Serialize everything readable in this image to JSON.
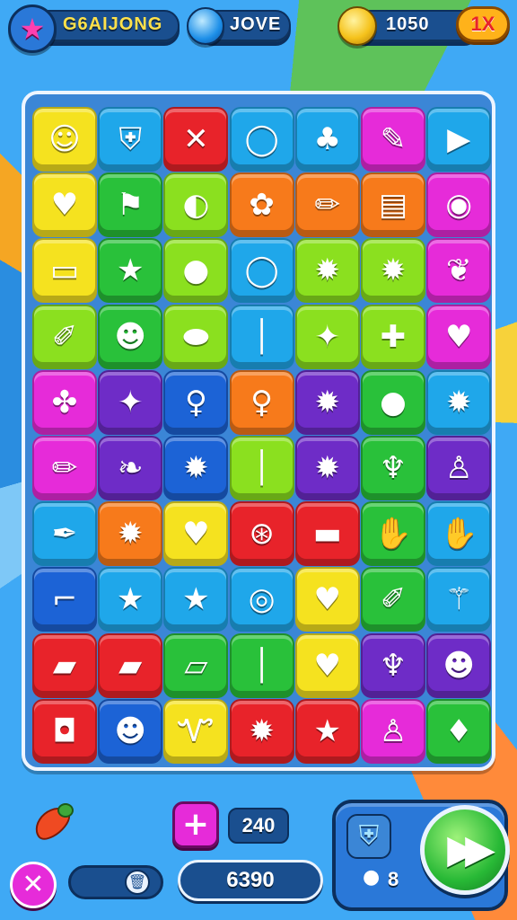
{
  "hud": {
    "player_name": "G6AIJONG",
    "gem_label": "JOVE",
    "coin_value": "1050",
    "multiplier_label": "1X"
  },
  "colors": {
    "red": "#e8232a",
    "orange": "#f77a1b",
    "yellow": "#f5e21f",
    "lime": "#8be01f",
    "green": "#29c13a",
    "cyan": "#1fa7ea",
    "blue": "#1c63d6",
    "purple": "#6e2cc7",
    "magenta": "#e62bd9"
  },
  "board": {
    "rows": [
      [
        {
          "c": "yellow",
          "icon": "character-icon"
        },
        {
          "c": "cyan",
          "icon": "shield-icon"
        },
        {
          "c": "red",
          "icon": "crossed-swords-icon"
        },
        {
          "c": "cyan",
          "icon": "ring-icon"
        },
        {
          "c": "cyan",
          "icon": "cactus-icon"
        },
        {
          "c": "magenta",
          "icon": "tool-icon"
        },
        {
          "c": "cyan",
          "icon": "play-icon"
        }
      ],
      [
        {
          "c": "yellow",
          "icon": "heart-icon"
        },
        {
          "c": "green",
          "icon": "flag-icon"
        },
        {
          "c": "lime",
          "icon": "pill-icon"
        },
        {
          "c": "orange",
          "icon": "cookie-icon"
        },
        {
          "c": "orange",
          "icon": "pencil-icon"
        },
        {
          "c": "orange",
          "icon": "book-icon"
        },
        {
          "c": "magenta",
          "icon": "ball-icon"
        }
      ],
      [
        {
          "c": "yellow",
          "icon": "card-icon"
        },
        {
          "c": "green",
          "icon": "star-icon"
        },
        {
          "c": "lime",
          "icon": "apple-icon"
        },
        {
          "c": "cyan",
          "icon": "ring-icon"
        },
        {
          "c": "lime",
          "icon": "gear-icon"
        },
        {
          "c": "lime",
          "icon": "gear-icon"
        },
        {
          "c": "magenta",
          "icon": "feather-icon"
        }
      ],
      [
        {
          "c": "lime",
          "icon": "crayon-icon"
        },
        {
          "c": "green",
          "icon": "bear-icon"
        },
        {
          "c": "lime",
          "icon": "candy-icon"
        },
        {
          "c": "cyan",
          "icon": "stick-icon"
        },
        {
          "c": "lime",
          "icon": "bird-icon"
        },
        {
          "c": "lime",
          "icon": "bone-icon"
        },
        {
          "c": "magenta",
          "icon": "heart-icon"
        }
      ],
      [
        {
          "c": "magenta",
          "icon": "puzzle-icon"
        },
        {
          "c": "purple",
          "icon": "bird-icon"
        },
        {
          "c": "blue",
          "icon": "key-icon"
        },
        {
          "c": "orange",
          "icon": "key-icon"
        },
        {
          "c": "purple",
          "icon": "gear-icon"
        },
        {
          "c": "green",
          "icon": "orange-fruit-icon"
        },
        {
          "c": "cyan",
          "icon": "gear-icon"
        }
      ],
      [
        {
          "c": "magenta",
          "icon": "pencil-icon"
        },
        {
          "c": "purple",
          "icon": "leaf-icon"
        },
        {
          "c": "blue",
          "icon": "gear-icon"
        },
        {
          "c": "lime",
          "icon": "stick-icon"
        },
        {
          "c": "purple",
          "icon": "gear-icon"
        },
        {
          "c": "green",
          "icon": "cup-icon"
        },
        {
          "c": "purple",
          "icon": "chair-icon"
        }
      ],
      [
        {
          "c": "cyan",
          "icon": "brush-icon"
        },
        {
          "c": "orange",
          "icon": "gear-icon"
        },
        {
          "c": "yellow",
          "icon": "heart-icon"
        },
        {
          "c": "red",
          "icon": "wheel-icon"
        },
        {
          "c": "red",
          "icon": "ruler-icon"
        },
        {
          "c": "green",
          "icon": "hand-icon"
        },
        {
          "c": "cyan",
          "icon": "hand-icon"
        }
      ],
      [
        {
          "c": "blue",
          "icon": "boot-icon"
        },
        {
          "c": "cyan",
          "icon": "star-icon"
        },
        {
          "c": "cyan",
          "icon": "star-icon"
        },
        {
          "c": "cyan",
          "icon": "target-icon"
        },
        {
          "c": "yellow",
          "icon": "heart-icon"
        },
        {
          "c": "green",
          "icon": "crayon-icon"
        },
        {
          "c": "cyan",
          "icon": "wand-icon"
        }
      ],
      [
        {
          "c": "red",
          "icon": "paper-icon"
        },
        {
          "c": "red",
          "icon": "paper-icon"
        },
        {
          "c": "green",
          "icon": "eraser-icon"
        },
        {
          "c": "green",
          "icon": "stick-icon"
        },
        {
          "c": "yellow",
          "icon": "heart-icon"
        },
        {
          "c": "purple",
          "icon": "cup-icon"
        },
        {
          "c": "purple",
          "icon": "dog-icon"
        }
      ],
      [
        {
          "c": "red",
          "icon": "camera-icon"
        },
        {
          "c": "blue",
          "icon": "bear-icon"
        },
        {
          "c": "yellow",
          "icon": "letter-icon"
        },
        {
          "c": "red",
          "icon": "gear-icon"
        },
        {
          "c": "red",
          "icon": "star-icon"
        },
        {
          "c": "magenta",
          "icon": "chair-icon"
        },
        {
          "c": "green",
          "icon": "bulb-icon"
        }
      ]
    ]
  },
  "bottom": {
    "moves_value": "240",
    "score_value": "6390",
    "bonus_count": "8"
  }
}
